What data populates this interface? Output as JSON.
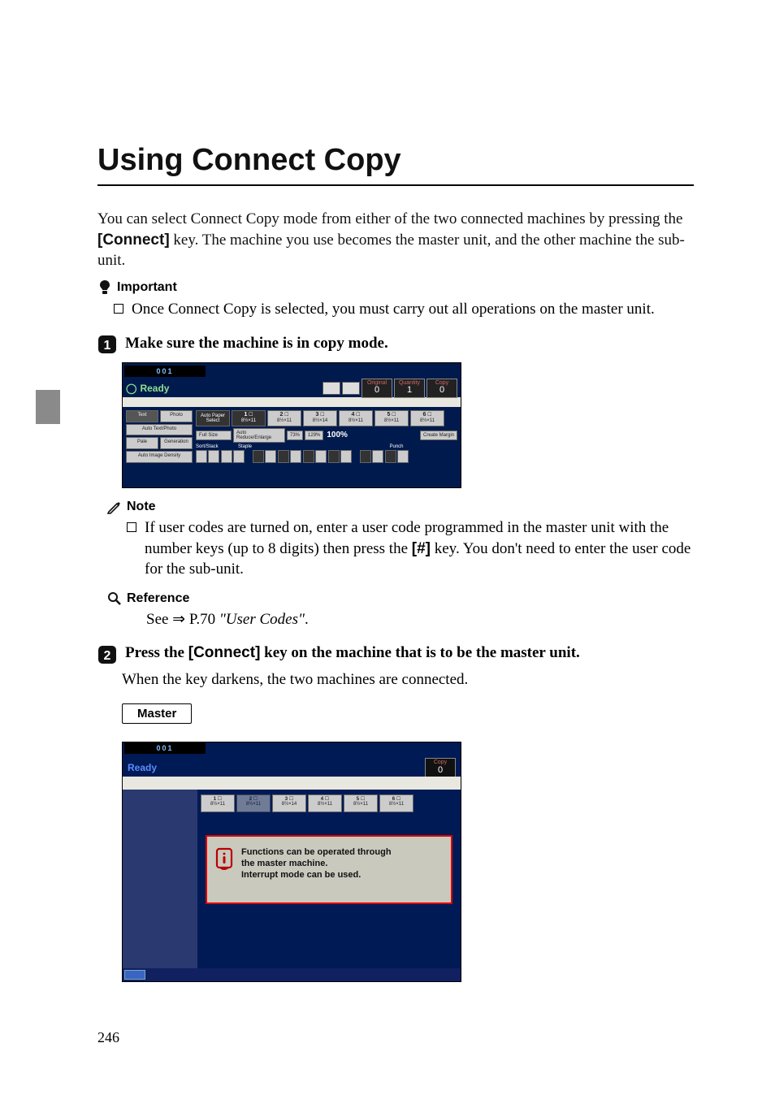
{
  "title": "Using Connect Copy",
  "intro": {
    "line1a": "You can select Connect Copy mode from either of the two connected machines",
    "line2a": "by pressing the ",
    "connect_key": "[Connect]",
    "line2b": " key. The machine you use becomes the master unit,",
    "line3": "and the other machine the sub-unit."
  },
  "important_label": "Important",
  "important_item": "Once Connect Copy is selected, you must carry out all operations on the master unit.",
  "step1": {
    "text": "Make sure the machine is in copy mode."
  },
  "panel1": {
    "id": "001",
    "ready": "Ready",
    "status": {
      "orig_lbl": "Original",
      "orig_v": "0",
      "qty_lbl": "Quantity",
      "qty_v": "1",
      "copy_lbl": "Copy",
      "copy_v": "0"
    },
    "left": {
      "text": "Text",
      "photo": "Photo",
      "atp": "Auto Text/Photo",
      "pale": "Pale",
      "gen": "Generation",
      "aid": "Auto Image Density"
    },
    "auto_paper": "Auto Paper Select",
    "trays": [
      {
        "n": "1",
        "sz": "8½×11"
      },
      {
        "n": "2",
        "sz": "8½×11"
      },
      {
        "n": "3",
        "sz": "8½×14"
      },
      {
        "n": "4",
        "sz": "8½×11"
      },
      {
        "n": "5",
        "sz": "8½×11"
      },
      {
        "n": "6",
        "sz": "8½×11"
      }
    ],
    "full_size": "Full Size",
    "are": "Auto Reduce/Enlarge",
    "z1": "73%",
    "z2": "129%",
    "z100": "100%",
    "cm": "Create Margin",
    "labels": {
      "sort": "Sort/Stack",
      "staple": "Staple",
      "punch": "Punch"
    }
  },
  "note_label": "Note",
  "note_item_a": "If user codes are turned on, enter a user code programmed in the master unit with the number keys (up to 8 digits) then press the ",
  "note_key": "[#]",
  "note_item_b": " key. You don't need to enter the user code for the sub-unit.",
  "reference_label": "Reference",
  "reference_prefix": "See ⇒ P.70 ",
  "reference_cite": "\"User Codes\"",
  "reference_suffix": ".",
  "step2": {
    "a": "Press the ",
    "k": "[Connect]",
    "b": " key on the machine that is to be the master unit."
  },
  "step2_body": "When the key darkens, the two machines are connected.",
  "master_box": "Master",
  "panel2": {
    "id": "001",
    "ready": "Ready",
    "copy_lbl": "Copy",
    "copy_v": "0",
    "trays": [
      {
        "n": "1",
        "sz": "8½×11"
      },
      {
        "n": "2",
        "sz": "8½×11"
      },
      {
        "n": "3",
        "sz": "8½×14"
      },
      {
        "n": "4",
        "sz": "8½×11"
      },
      {
        "n": "5",
        "sz": "8½×11"
      },
      {
        "n": "6",
        "sz": "8½×11"
      }
    ],
    "msg1": "Functions can be operated through",
    "msg2": "the master machine.",
    "msg3": "Interrupt mode can be used."
  },
  "pagenum": "246"
}
